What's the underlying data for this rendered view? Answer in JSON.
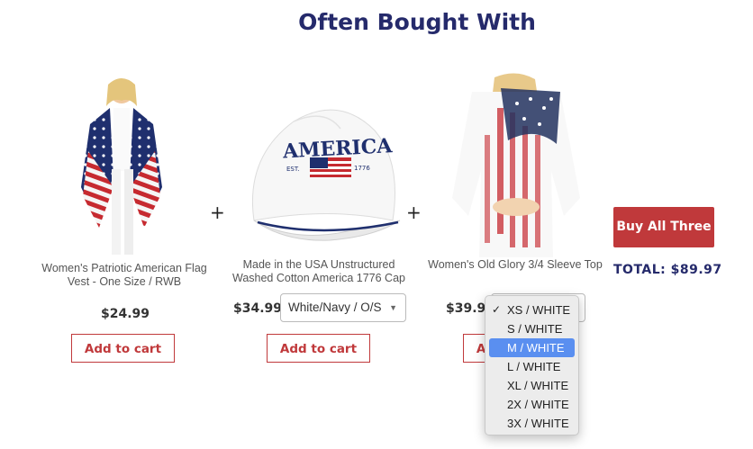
{
  "heading": "Often Bought With",
  "products": [
    {
      "name": "Women's Patriotic American Flag Vest - One Size / RWB",
      "price": "$24.99",
      "add_label": "Add to cart"
    },
    {
      "name": "Made in the USA Unstructured Washed Cotton America 1776 Cap",
      "price": "$34.99",
      "add_label": "Add to cart",
      "variant": "White/Navy / O/S",
      "cap_text": "AMERICA",
      "cap_est": "EST.",
      "cap_year": "1776"
    },
    {
      "name": "Women's Old Glory 3/4 Sleeve Top",
      "price": "$39.99",
      "add_label": "Add to cart",
      "variant": "XS / WHITE"
    }
  ],
  "plus_sign": "+",
  "buy_all_label": "Buy All Three",
  "total_label": "TOTAL: $89.97",
  "dropdown": {
    "checked": "XS / WHITE",
    "highlighted": "M / WHITE",
    "options": [
      "XS / WHITE",
      "S / WHITE",
      "M / WHITE",
      "L / WHITE",
      "XL / WHITE",
      "2X / WHITE",
      "3X / WHITE"
    ]
  },
  "colors": {
    "navy": "#252a6b",
    "red": "#c0393b",
    "highlight": "#5a8ff0"
  },
  "icons": {
    "plus": "plus-icon",
    "caret": "caret-down-icon",
    "check": "checkmark-icon"
  }
}
